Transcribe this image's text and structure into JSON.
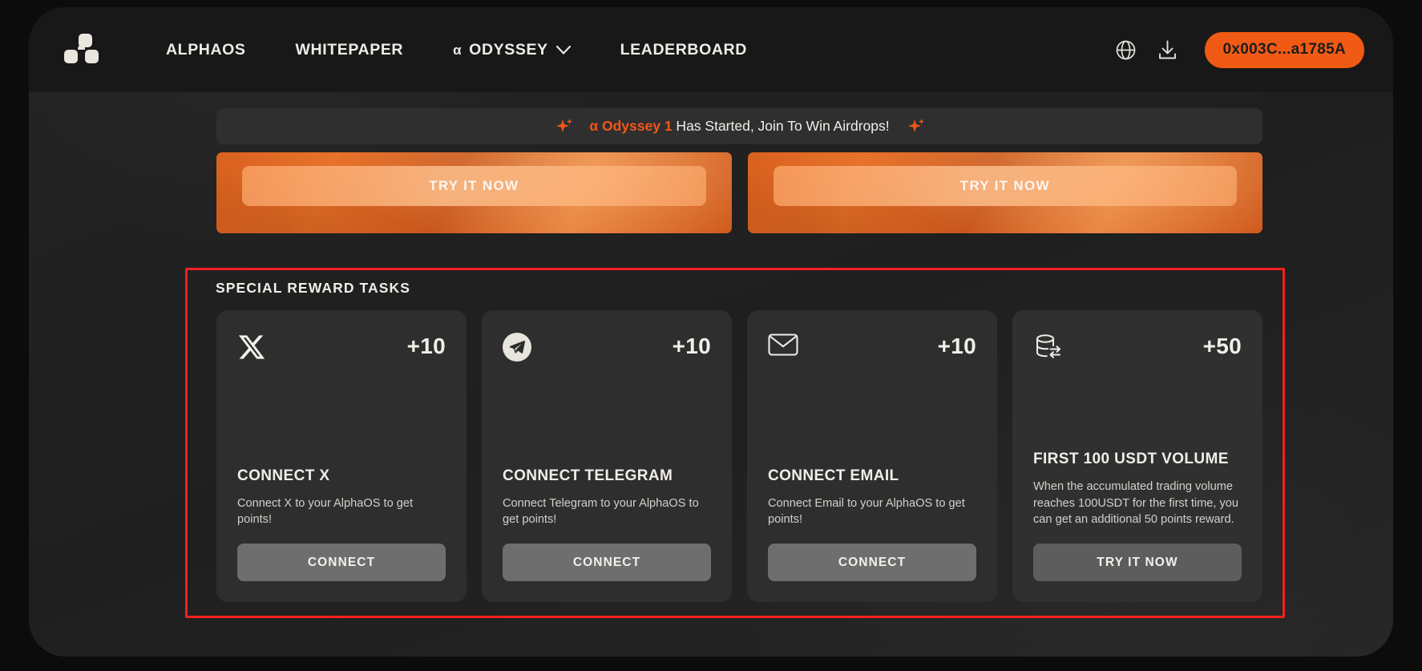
{
  "nav": {
    "logo_name": "alphaos-logo",
    "links": [
      {
        "label": "ALPHAOS",
        "has_chevron": false,
        "alpha_prefix": ""
      },
      {
        "label": "WHITEPAPER",
        "has_chevron": false,
        "alpha_prefix": ""
      },
      {
        "label": "ODYSSEY",
        "has_chevron": true,
        "alpha_prefix": "α"
      },
      {
        "label": "LEADERBOARD",
        "has_chevron": false,
        "alpha_prefix": ""
      }
    ],
    "globe_icon": "globe-icon",
    "download_icon": "download-icon",
    "wallet_label": "0x003C...a1785A"
  },
  "announcement": {
    "left_sparkle": "sparkle-icon",
    "right_sparkle": "sparkle-icon",
    "highlight": "α Odyssey 1",
    "rest": " Has Started, Join To Win Airdrops!"
  },
  "promos": [
    {
      "button_label": "TRY IT NOW"
    },
    {
      "button_label": "TRY IT NOW"
    }
  ],
  "tasks": {
    "section_title": "SPECIAL REWARD TASKS",
    "cards": [
      {
        "icon": "x-twitter-icon",
        "points": "+10",
        "title": "CONNECT X",
        "description": "Connect X to your AlphaOS to get points!",
        "button_label": "CONNECT"
      },
      {
        "icon": "telegram-icon",
        "points": "+10",
        "title": "CONNECT TELEGRAM",
        "description": "Connect Telegram to your AlphaOS to get points!",
        "button_label": "CONNECT"
      },
      {
        "icon": "envelope-icon",
        "points": "+10",
        "title": "CONNECT EMAIL",
        "description": "Connect Email to your AlphaOS to get points!",
        "button_label": "CONNECT"
      },
      {
        "icon": "database-exchange-icon",
        "points": "+50",
        "title": "FIRST 100 USDT VOLUME",
        "description": "When the accumulated trading volume reaches 100USDT for the first time, you can get an additional 50 points reward.",
        "button_label": "TRY IT NOW"
      }
    ]
  },
  "colors": {
    "accent_orange": "#f05a14",
    "annotation_red": "#f42020",
    "card_bg": "#2e2e2e",
    "nav_bg": "#181818"
  }
}
